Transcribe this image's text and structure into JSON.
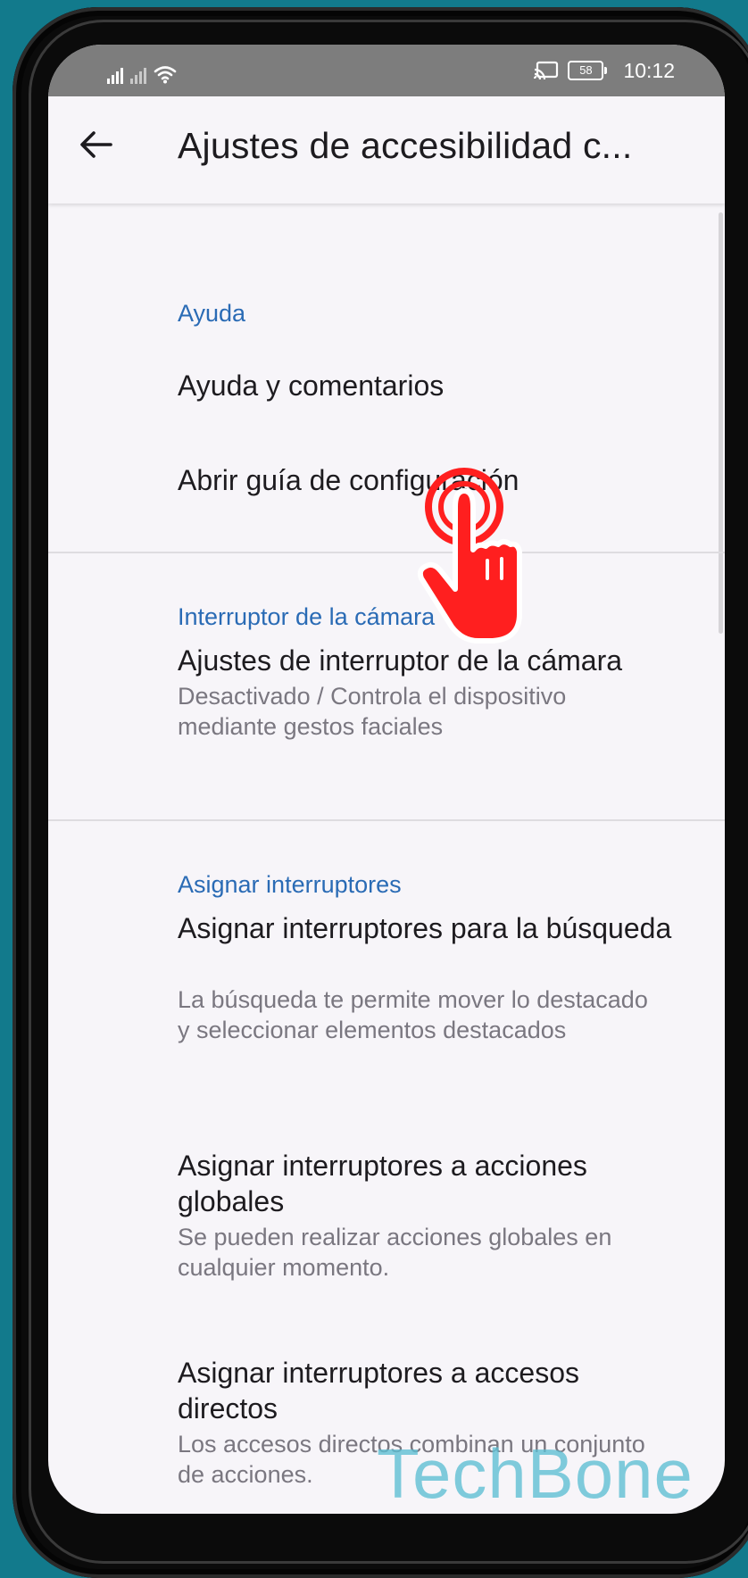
{
  "status_bar": {
    "time": "10:12",
    "battery": "58",
    "icons": [
      "signal-icon",
      "signal-no-sim-icon",
      "wifi-icon",
      "cast-icon",
      "battery-icon"
    ]
  },
  "app_bar": {
    "back_icon": "arrow-left-icon",
    "title": "Ajustes de accesibilidad c..."
  },
  "sections": [
    {
      "header": "Ayuda",
      "items": [
        {
          "title": "Ayuda y comentarios"
        },
        {
          "title": "Abrir guía de configuración"
        }
      ]
    },
    {
      "header": "Interruptor de la cámara",
      "items": [
        {
          "title": "Ajustes de interruptor de la cámara",
          "subtitle": "Desactivado / Controla el dispositivo mediante gestos faciales"
        }
      ]
    },
    {
      "header": "Asignar interruptores",
      "items": [
        {
          "title": "Asignar interruptores para la búsqueda",
          "subtitle": "La búsqueda te permite mover lo destacado y seleccionar elementos destacados"
        },
        {
          "title": "Asignar interruptores a acciones globales",
          "subtitle": "Se pueden realizar acciones globales en cualquier momento."
        },
        {
          "title": "Asignar interruptores a accesos directos",
          "subtitle": "Los accesos directos combinan un conjunto de acciones."
        }
      ]
    }
  ],
  "overlay": {
    "tap_indicator_icon": "tap-hand-icon",
    "watermark": "TechBone",
    "tap_color": "#ff1f1f",
    "watermark_color": "#5cbed2"
  },
  "colors": {
    "section_header": "#2a6bb5",
    "background": "#f7f5f9",
    "outer_background": "#127a8c"
  }
}
